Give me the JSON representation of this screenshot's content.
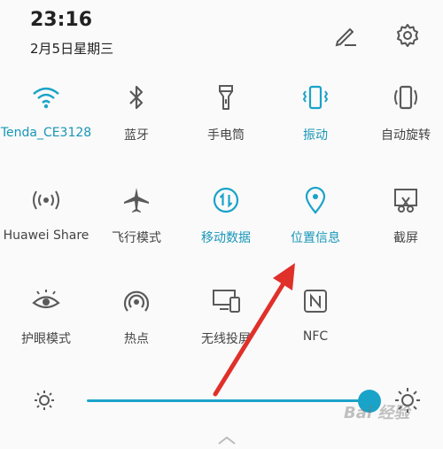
{
  "status": {
    "time": "23:16",
    "date": "2月5日星期三"
  },
  "header": {
    "edit_icon": "pencil-icon",
    "settings_icon": "gear-icon"
  },
  "colors": {
    "accent": "#1aa3c9",
    "icon_off": "#5a5a5a",
    "annotation_arrow": "#e0302a"
  },
  "tiles": [
    {
      "label": "Tenda_CE3128",
      "icon": "wifi-icon",
      "active": true
    },
    {
      "label": "蓝牙",
      "icon": "bluetooth-icon",
      "active": false
    },
    {
      "label": "手电筒",
      "icon": "flashlight-icon",
      "active": false
    },
    {
      "label": "振动",
      "icon": "vibrate-icon",
      "active": true
    },
    {
      "label": "自动旋转",
      "icon": "auto-rotate-icon",
      "active": false
    },
    {
      "label": "Huawei Share",
      "icon": "huawei-share-icon",
      "active": false
    },
    {
      "label": "飞行模式",
      "icon": "airplane-icon",
      "active": false
    },
    {
      "label": "移动数据",
      "icon": "mobile-data-icon",
      "active": true
    },
    {
      "label": "位置信息",
      "icon": "location-icon",
      "active": true
    },
    {
      "label": "截屏",
      "icon": "screenshot-icon",
      "active": false
    },
    {
      "label": "护眼模式",
      "icon": "eye-icon",
      "active": false
    },
    {
      "label": "热点",
      "icon": "hotspot-icon",
      "active": false
    },
    {
      "label": "无线投屏",
      "icon": "cast-icon",
      "active": false
    },
    {
      "label": "NFC",
      "icon": "nfc-icon",
      "active": false
    }
  ],
  "brightness": {
    "level": 0.98,
    "low_icon": "brightness-low-icon",
    "high_icon": "brightness-high-icon"
  },
  "watermark": "Bai 经验"
}
